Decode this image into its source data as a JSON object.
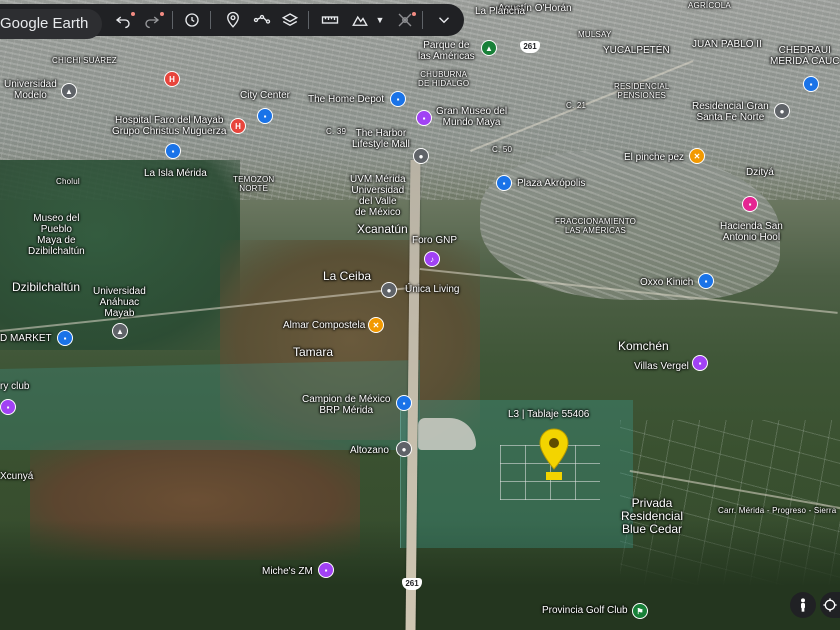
{
  "toolbar": {
    "brand": "Google Earth",
    "tools": [
      "undo-icon",
      "redo-icon",
      "history-icon",
      "placemark-icon",
      "path-icon",
      "layers-icon",
      "measure-icon",
      "elevation-icon",
      "no-imagery-icon",
      "chevron-down-icon"
    ]
  },
  "map": {
    "places": {
      "chichi": "CHICHI SUÁREZ",
      "agustin": "Agustín O'Horán",
      "laplancha": "La Plancha",
      "agricola": "AGRÍCOLA",
      "mulsay": "MULSAY",
      "yucalpeten": "YUCALPETÉN",
      "juanpablo": "JUAN PABLO II",
      "chedraui": "CHEDRAUI\nMERIDA CAUC",
      "parque": "Parque de\nlas Américas",
      "chuburna": "CHUBURNA\nDE HIDALGO",
      "residencial": "RESIDENCIAL\nPENSIONES",
      "univmodelo": "Universidad\nModelo",
      "hospital": "Hospital Faro del Mayab\nGrupo Christus Muguerza",
      "citycenter": "City Center",
      "homedepot": "The Home Depot",
      "granmuseo": "Gran Museo del\nMundo Maya",
      "resgran": "Residencial Gran\nSanta Fe Norte",
      "c39": "C. 39",
      "harbor": "The Harbor\nLifestyle Mall",
      "c50": "C. 50",
      "c21": "C. 21",
      "pinchepez": "El pinche pez",
      "dzitya": "Dzityá",
      "islamerida": "La Isla Mérida",
      "temozon": "TEMOZON\nNORTE",
      "uvm": "UVM Mérida\nUniversidad\ndel Valle\nde México",
      "plazaakro": "Plaza Akrópolis",
      "cholul": "Cholul",
      "museopueblo": "Museo del\nPueblo\nMaya de\nDzibilchaltún",
      "fraccionamiento": "FRACCIONAMIENTO\nLAS AMÉRICAS",
      "haciendasan": "Hacienda San\nAntonio Hool",
      "xcanatun": "Xcanatún",
      "forognp": "Foro GNP",
      "laceiba": "La Ceiba",
      "unicaliving": "Única Living",
      "oxxo": "Oxxo Kinich",
      "dzibilchaltun": "Dzibilchaltún",
      "univanahuac": "Universidad\nAnáhuac\nMayab",
      "dmarket": "D MARKET",
      "almar": "Almar Compostela",
      "tamara": "Tamara",
      "komchen": "Komchén",
      "villasvergel": "Villas Vergel",
      "ryclub": "ry club",
      "campion": "Campion de México\nBRP Mérida",
      "tablaje": "L3 | Tablaje 55406",
      "altozano": "Altozano",
      "xcunya": "Xcunyá",
      "privada": "Privada\nResidencial\nBlue Cedar",
      "carr": "Carr. Mérida - Progreso - Sierra",
      "miches": "Miche's ZM",
      "provincia": "Provincia Golf Club"
    },
    "road_shields": [
      "261",
      "261"
    ],
    "pin_letters": {
      "hospital_a": "H",
      "hospital_b": "H",
      "chedraui": "🛒"
    }
  },
  "colors": {
    "toolbar": "#202124",
    "parcel": "#3ca096",
    "marker": "#f3d400",
    "pin_blue": "#1a73e8",
    "pin_red": "#e8453c",
    "pin_purple": "#a142f4",
    "pin_orange": "#f29900",
    "pin_green": "#188038",
    "pin_pink": "#e52592",
    "pin_gray": "#5f6368"
  }
}
